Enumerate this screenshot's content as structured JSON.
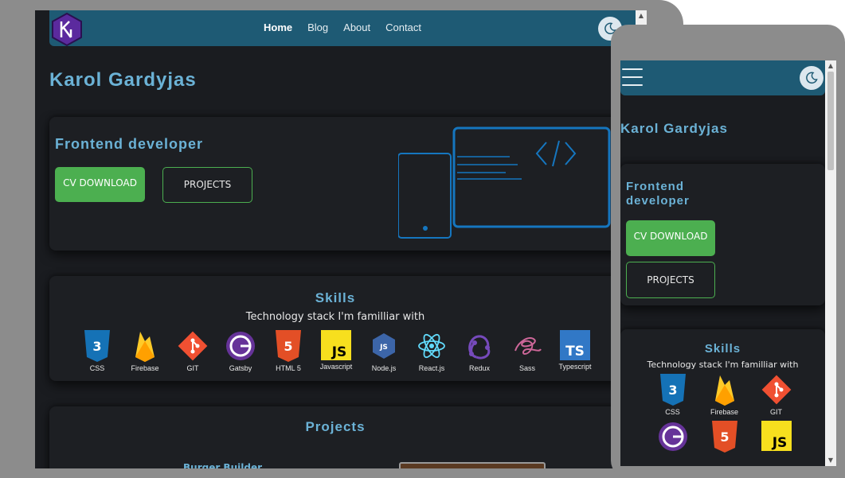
{
  "nav": {
    "links": [
      "Home",
      "Blog",
      "About",
      "Contact"
    ]
  },
  "owner_name": "Karol Gardyjas",
  "hero": {
    "role": "Frontend developer",
    "cv_button": "CV DOWNLOAD",
    "projects_button": "PROJECTS"
  },
  "skills": {
    "title": "Skills",
    "subtitle": "Technology stack I'm familliar with",
    "items": [
      "CSS",
      "Firebase",
      "GIT",
      "Gatsby",
      "HTML 5",
      "Javascript",
      "Node.js",
      "React.js",
      "Redux",
      "Sass",
      "Typescript"
    ]
  },
  "projects": {
    "title": "Projects",
    "first_project": "Burger Builder"
  },
  "icons": {
    "logo": "hexagon-logo-icon",
    "theme": "moon-icon",
    "menu": "hamburger-menu-icon"
  },
  "colors": {
    "nav": "#1e5a74",
    "accent": "#6bb2d6",
    "button_green": "#4caf50",
    "background": "#1a1c20"
  }
}
